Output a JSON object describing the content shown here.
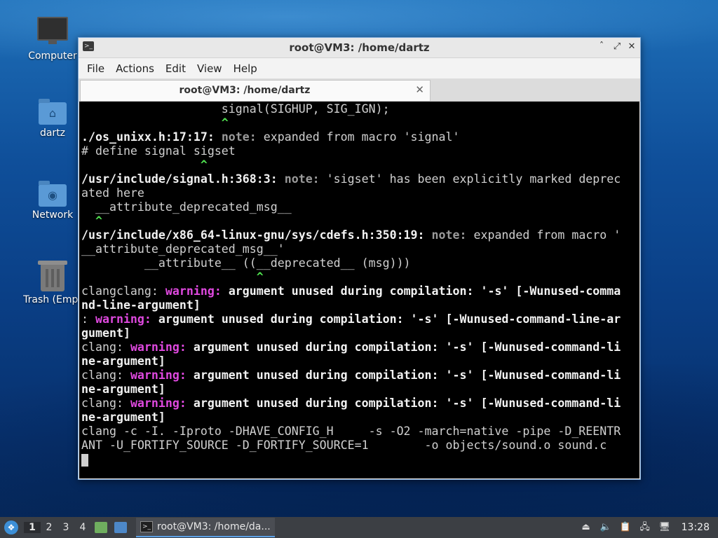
{
  "desktop": {
    "icons": [
      {
        "label": "Computer",
        "icon": "computer-icon"
      },
      {
        "label": "dartz",
        "icon": "home-folder-icon"
      },
      {
        "label": "Network",
        "icon": "network-folder-icon"
      },
      {
        "label": "Trash (Empt",
        "icon": "trash-icon"
      }
    ]
  },
  "window": {
    "title": "root@VM3: /home/dartz",
    "controls": {
      "minimize": "ˆ",
      "maximize": "⤢",
      "close": "✕"
    },
    "menu": [
      "File",
      "Actions",
      "Edit",
      "View",
      "Help"
    ],
    "tab": {
      "title": "root@VM3: /home/dartz",
      "close": "✕"
    }
  },
  "terminal": {
    "lines": [
      [
        {
          "t": "                    signal(SIGHUP, SIG_IGN);",
          "s": "normal"
        }
      ],
      [
        {
          "t": "                    ^",
          "s": "caret"
        }
      ],
      [
        {
          "t": "./os_unixx.h:17:17: ",
          "s": "bold"
        },
        {
          "t": "note: ",
          "s": "note"
        },
        {
          "t": "expanded from macro 'signal'",
          "s": "normal"
        }
      ],
      [
        {
          "t": "# define signal sigset",
          "s": "normal"
        }
      ],
      [
        {
          "t": "                 ^",
          "s": "caret"
        }
      ],
      [
        {
          "t": "/usr/include/signal.h:368:3: ",
          "s": "bold"
        },
        {
          "t": "note: ",
          "s": "note"
        },
        {
          "t": "'sigset' has been explicitly marked deprec",
          "s": "normal"
        }
      ],
      [
        {
          "t": "ated here",
          "s": "normal"
        }
      ],
      [
        {
          "t": "  __attribute_deprecated_msg__",
          "s": "normal"
        }
      ],
      [
        {
          "t": "  ^",
          "s": "caret"
        }
      ],
      [
        {
          "t": "/usr/include/x86_64-linux-gnu/sys/cdefs.h:350:19: ",
          "s": "bold"
        },
        {
          "t": "note: ",
          "s": "note"
        },
        {
          "t": "expanded from macro '",
          "s": "normal"
        }
      ],
      [
        {
          "t": "__attribute_deprecated_msg__'",
          "s": "normal"
        }
      ],
      [
        {
          "t": "         __attribute__ ((__deprecated__ (msg)))",
          "s": "normal"
        }
      ],
      [
        {
          "t": "                         ^",
          "s": "caret"
        }
      ],
      [
        {
          "t": "clangclang: ",
          "s": "normal"
        },
        {
          "t": "warning: ",
          "s": "warn"
        },
        {
          "t": "argument unused during compilation: '-s' [-Wunused-comma",
          "s": "bold"
        }
      ],
      [
        {
          "t": "nd-line-argument]",
          "s": "bold"
        }
      ],
      [
        {
          "t": ": ",
          "s": "normal"
        },
        {
          "t": "warning: ",
          "s": "warn"
        },
        {
          "t": "argument unused during compilation: '-s' [-Wunused-command-line-ar",
          "s": "bold"
        }
      ],
      [
        {
          "t": "gument]",
          "s": "bold"
        }
      ],
      [
        {
          "t": "clang: ",
          "s": "normal"
        },
        {
          "t": "warning: ",
          "s": "warn"
        },
        {
          "t": "argument unused during compilation: '-s' [-Wunused-command-li",
          "s": "bold"
        }
      ],
      [
        {
          "t": "ne-argument]",
          "s": "bold"
        }
      ],
      [
        {
          "t": "clang: ",
          "s": "normal"
        },
        {
          "t": "warning: ",
          "s": "warn"
        },
        {
          "t": "argument unused during compilation: '-s' [-Wunused-command-li",
          "s": "bold"
        }
      ],
      [
        {
          "t": "ne-argument]",
          "s": "bold"
        }
      ],
      [
        {
          "t": "clang: ",
          "s": "normal"
        },
        {
          "t": "warning: ",
          "s": "warn"
        },
        {
          "t": "argument unused during compilation: '-s' [-Wunused-command-li",
          "s": "bold"
        }
      ],
      [
        {
          "t": "ne-argument]",
          "s": "bold"
        }
      ],
      [
        {
          "t": "clang -c -I. -Iproto -DHAVE_CONFIG_H     -s -O2 -march=native -pipe -D_REENTR",
          "s": "normal"
        }
      ],
      [
        {
          "t": "ANT -U_FORTIFY_SOURCE -D_FORTIFY_SOURCE=1        -o objects/sound.o sound.c",
          "s": "normal"
        }
      ]
    ]
  },
  "taskbar": {
    "workspaces": [
      "1",
      "2",
      "3",
      "4"
    ],
    "active_workspace": "1",
    "task_label": "root@VM3: /home/da...",
    "clock": "13:28"
  }
}
